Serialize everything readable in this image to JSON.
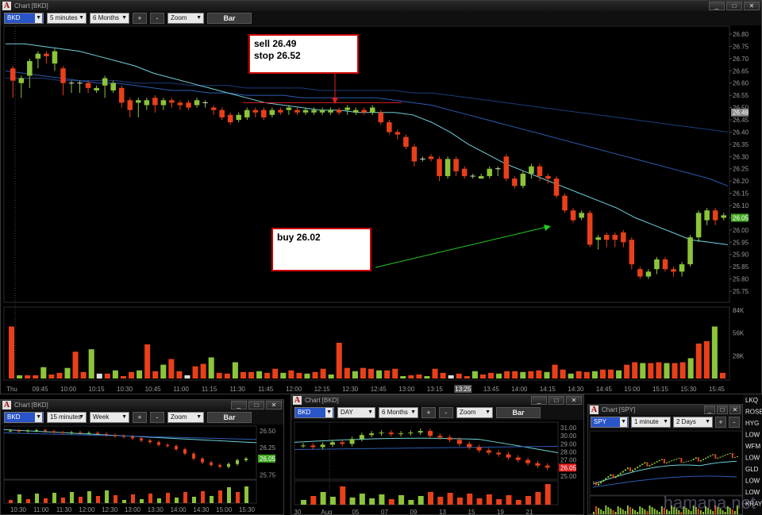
{
  "main": {
    "title": "Chart [BKD]",
    "symbol": "BKD",
    "interval": "5 minutes",
    "range": "6 Months",
    "plus": "+",
    "minus": "-",
    "zoom": "Zoom",
    "mode": "Bar",
    "notes": {
      "sell": "sell 26.49\nstop 26.52",
      "buy": "buy 26.02"
    },
    "price_ticks": [
      "26.80",
      "26.75",
      "26.70",
      "26.65",
      "26.60",
      "26.55",
      "26.50",
      "26.45",
      "26.40",
      "26.35",
      "26.30",
      "26.25",
      "26.20",
      "26.15",
      "26.10",
      "26.05",
      "26.00",
      "25.95",
      "25.90",
      "25.85",
      "25.80",
      "25.75"
    ],
    "price_markers": [
      {
        "label": "26.48",
        "value": 26.48,
        "color": "#888888"
      },
      {
        "label": "26.05",
        "value": 26.05,
        "color": "#44aa22"
      }
    ],
    "volume_ticks": [
      "84K",
      "56K",
      "28K"
    ],
    "time_ticks": [
      "Thu",
      "09:45",
      "10:00",
      "10:15",
      "10:30",
      "10:45",
      "11:00",
      "11:15",
      "11:30",
      "11:45",
      "12:00",
      "12:15",
      "12:30",
      "12:45",
      "13:00",
      "13:15",
      "13:25",
      "13:45",
      "14:00",
      "14:15",
      "14:30",
      "14:45",
      "15:00",
      "15:15",
      "15:30",
      "15:45"
    ]
  },
  "sub1": {
    "title": "Chart [BKD]",
    "symbol": "BKD",
    "interval": "15 minutes",
    "range": "Week",
    "plus": "+",
    "minus": "-",
    "zoom": "Zoom",
    "mode": "Bar",
    "price_ticks": [
      "26.50",
      "26.25",
      "26.05",
      "25.75"
    ],
    "time_ticks": [
      "10:30",
      "11:00",
      "11:30",
      "12:00",
      "12:30",
      "13:00",
      "13:30",
      "14:00",
      "14:30",
      "15:00",
      "15:30"
    ]
  },
  "sub2": {
    "title": "Chart [BKD]",
    "symbol": "BKD",
    "interval": "DAY",
    "range": "6 Months",
    "plus": "+",
    "minus": "-",
    "zoom": "Zoom",
    "mode": "Bar",
    "price_ticks": [
      "31.00",
      "30.00",
      "29.00",
      "28.00",
      "27.00",
      "26.05",
      "25.00"
    ],
    "time_ticks": [
      "30",
      "Aug",
      "05",
      "07",
      "09",
      "13",
      "15",
      "19",
      "21"
    ]
  },
  "sub3": {
    "title": "Chart [SPY]",
    "symbol": "SPY",
    "interval": "1 minute",
    "range": "2 Days",
    "plus": "+",
    "minus": "-",
    "side_labels": [
      "LKQ",
      "ROSE",
      "HYG",
      "LOW",
      "WFM",
      "LOW",
      "GLD",
      "LOW",
      "LOW",
      "KRAY"
    ]
  },
  "window_buttons": {
    "min": "_",
    "max": "□",
    "close": "✕"
  },
  "watermark": "hamana.net",
  "chart_data": {
    "type": "candlestick",
    "symbol": "BKD",
    "interval": "5 minutes",
    "ylim": [
      25.75,
      26.8
    ],
    "annotations": [
      {
        "text": "sell 26.49",
        "kind": "note"
      },
      {
        "text": "stop 26.52",
        "kind": "note",
        "line_value": 26.52
      },
      {
        "text": "buy 26.02",
        "kind": "note"
      }
    ],
    "candles": [
      [
        26.66,
        26.61,
        26.54
      ],
      [
        26.6,
        26.62,
        26.54
      ],
      [
        26.63,
        26.69,
        26.58
      ],
      [
        26.7,
        26.72,
        26.66
      ],
      [
        26.72,
        26.71,
        26.68
      ],
      [
        26.68,
        26.73,
        26.65
      ],
      [
        26.66,
        26.6,
        26.55
      ],
      [
        26.6,
        26.6,
        26.56
      ],
      [
        26.6,
        26.6,
        26.56
      ],
      [
        26.6,
        26.58,
        26.56
      ],
      [
        26.57,
        26.58,
        26.56
      ],
      [
        26.59,
        26.62,
        26.54
      ],
      [
        26.57,
        26.6,
        26.56
      ],
      [
        26.58,
        26.52,
        26.5
      ],
      [
        26.53,
        26.49,
        26.46
      ],
      [
        26.52,
        26.53,
        26.46
      ],
      [
        26.51,
        26.53,
        26.49
      ],
      [
        26.54,
        26.51,
        26.48
      ],
      [
        26.51,
        26.53,
        26.49
      ],
      [
        26.53,
        26.52,
        26.5
      ],
      [
        26.52,
        26.51,
        26.49
      ],
      [
        26.52,
        26.5,
        26.49
      ],
      [
        26.51,
        26.53,
        26.5
      ],
      [
        26.52,
        26.52,
        26.5
      ],
      [
        26.5,
        26.49,
        26.47
      ],
      [
        26.49,
        26.46,
        26.45
      ],
      [
        26.47,
        26.44,
        26.43
      ],
      [
        26.45,
        26.47,
        26.44
      ],
      [
        26.46,
        26.49,
        26.45
      ],
      [
        26.49,
        26.48,
        26.46
      ],
      [
        26.49,
        26.46,
        26.45
      ],
      [
        26.47,
        26.49,
        26.46
      ],
      [
        26.49,
        26.48,
        26.47
      ],
      [
        26.49,
        26.5,
        26.47
      ],
      [
        26.49,
        26.48,
        26.47
      ],
      [
        26.48,
        26.49,
        26.47
      ],
      [
        26.48,
        26.49,
        26.47
      ],
      [
        26.48,
        26.49,
        26.47
      ],
      [
        26.48,
        26.49,
        26.47
      ],
      [
        26.49,
        26.48,
        26.47
      ],
      [
        26.49,
        26.5,
        26.47
      ],
      [
        26.48,
        26.49,
        26.47
      ],
      [
        26.49,
        26.48,
        26.47
      ],
      [
        26.48,
        26.5,
        26.47
      ],
      [
        26.48,
        26.44,
        26.43
      ],
      [
        26.44,
        26.4,
        26.39
      ],
      [
        26.4,
        26.39,
        26.37
      ],
      [
        26.38,
        26.34,
        26.33
      ],
      [
        26.34,
        26.28,
        26.26
      ],
      [
        26.29,
        26.29,
        26.28
      ],
      [
        26.3,
        26.29,
        26.28
      ],
      [
        26.29,
        26.22,
        26.2
      ],
      [
        26.22,
        26.29,
        26.21
      ],
      [
        26.29,
        26.24,
        26.22
      ],
      [
        26.25,
        26.22,
        26.21
      ],
      [
        26.22,
        26.22,
        26.21
      ],
      [
        26.21,
        26.22,
        26.21
      ],
      [
        26.22,
        26.25,
        26.21
      ],
      [
        26.25,
        26.25,
        26.22
      ],
      [
        26.3,
        26.21,
        26.2
      ],
      [
        26.21,
        26.18,
        26.17
      ],
      [
        26.18,
        26.23,
        26.17
      ],
      [
        26.23,
        26.26,
        26.21
      ],
      [
        26.26,
        26.22,
        26.2
      ],
      [
        26.22,
        26.21,
        26.19
      ],
      [
        26.21,
        26.14,
        26.13
      ],
      [
        26.14,
        26.08,
        26.07
      ],
      [
        26.08,
        26.04,
        26.03
      ],
      [
        26.05,
        26.07,
        26.04
      ],
      [
        26.07,
        25.94,
        25.93
      ],
      [
        25.96,
        25.97,
        25.92
      ],
      [
        25.98,
        25.96,
        25.93
      ],
      [
        25.98,
        25.96,
        25.93
      ],
      [
        25.99,
        25.95,
        25.93
      ],
      [
        25.96,
        25.86,
        25.84
      ],
      [
        25.84,
        25.81,
        25.8
      ],
      [
        25.81,
        25.83,
        25.8
      ],
      [
        25.84,
        25.88,
        25.82
      ],
      [
        25.88,
        25.84,
        25.83
      ],
      [
        25.84,
        25.83,
        25.81
      ],
      [
        25.83,
        25.86,
        25.81
      ],
      [
        25.86,
        25.97,
        25.85
      ],
      [
        25.97,
        26.07,
        25.95
      ],
      [
        26.04,
        26.08,
        26.02
      ],
      [
        26.08,
        26.04,
        26.02
      ],
      [
        26.05,
        26.06,
        26.04
      ]
    ],
    "ma_fast": [
      26.76,
      26.76,
      26.75,
      26.74,
      26.73,
      26.71,
      26.69,
      26.67,
      26.64,
      26.62,
      26.6,
      26.58,
      26.56,
      26.54,
      26.52,
      26.51,
      26.5,
      26.49,
      26.49,
      26.48,
      26.48,
      26.48,
      26.47,
      26.44,
      26.4,
      26.35,
      26.31,
      26.27,
      26.24,
      26.21,
      26.18,
      26.15,
      26.12,
      26.09,
      26.05,
      26.02,
      25.99,
      25.96,
      25.95,
      25.94
    ],
    "ma_slow": [
      26.65,
      26.64,
      26.63,
      26.62,
      26.61,
      26.6,
      26.6,
      26.59,
      26.58,
      26.57,
      26.57,
      26.56,
      26.56,
      26.55,
      26.55,
      26.55,
      26.54,
      26.54,
      26.54,
      26.54,
      26.54,
      26.53,
      26.52,
      26.51,
      26.49,
      26.47,
      26.45,
      26.43,
      26.41,
      26.39,
      26.37,
      26.35,
      26.33,
      26.31,
      26.29,
      26.27,
      26.25,
      26.23,
      26.21,
      26.18
    ],
    "ma_slow2": [
      26.62,
      26.62,
      26.62,
      26.61,
      26.61,
      26.61,
      26.61,
      26.6,
      26.6,
      26.6,
      26.59,
      26.59,
      26.59,
      26.58,
      26.58,
      26.58,
      26.58,
      26.57,
      26.57,
      26.57,
      26.57,
      26.57,
      26.56,
      26.56,
      26.55,
      26.54,
      26.53,
      26.52,
      26.51,
      26.5,
      26.49,
      26.48,
      26.47,
      26.46,
      26.45,
      26.44,
      26.43,
      26.42,
      26.41,
      26.4
    ],
    "volume_max": 84000,
    "volume": [
      64,
      4,
      4,
      4,
      14,
      5,
      7,
      13,
      33,
      8,
      36,
      6,
      6,
      10,
      3,
      8,
      10,
      42,
      9,
      17,
      24,
      9,
      4,
      15,
      18,
      26,
      7,
      6,
      20,
      8,
      8,
      9,
      7,
      12,
      7,
      10,
      7,
      6,
      8,
      12,
      5,
      44,
      13,
      9,
      13,
      12,
      10,
      10,
      12,
      3,
      4,
      5,
      3,
      12,
      7,
      4,
      6,
      3,
      9,
      5,
      7,
      6,
      9,
      9,
      8,
      9,
      10,
      8,
      17,
      11,
      6,
      9,
      8,
      9,
      11,
      11,
      10,
      17,
      20,
      19,
      19,
      20,
      19,
      19,
      20,
      25,
      43,
      46,
      64,
      7
    ]
  }
}
